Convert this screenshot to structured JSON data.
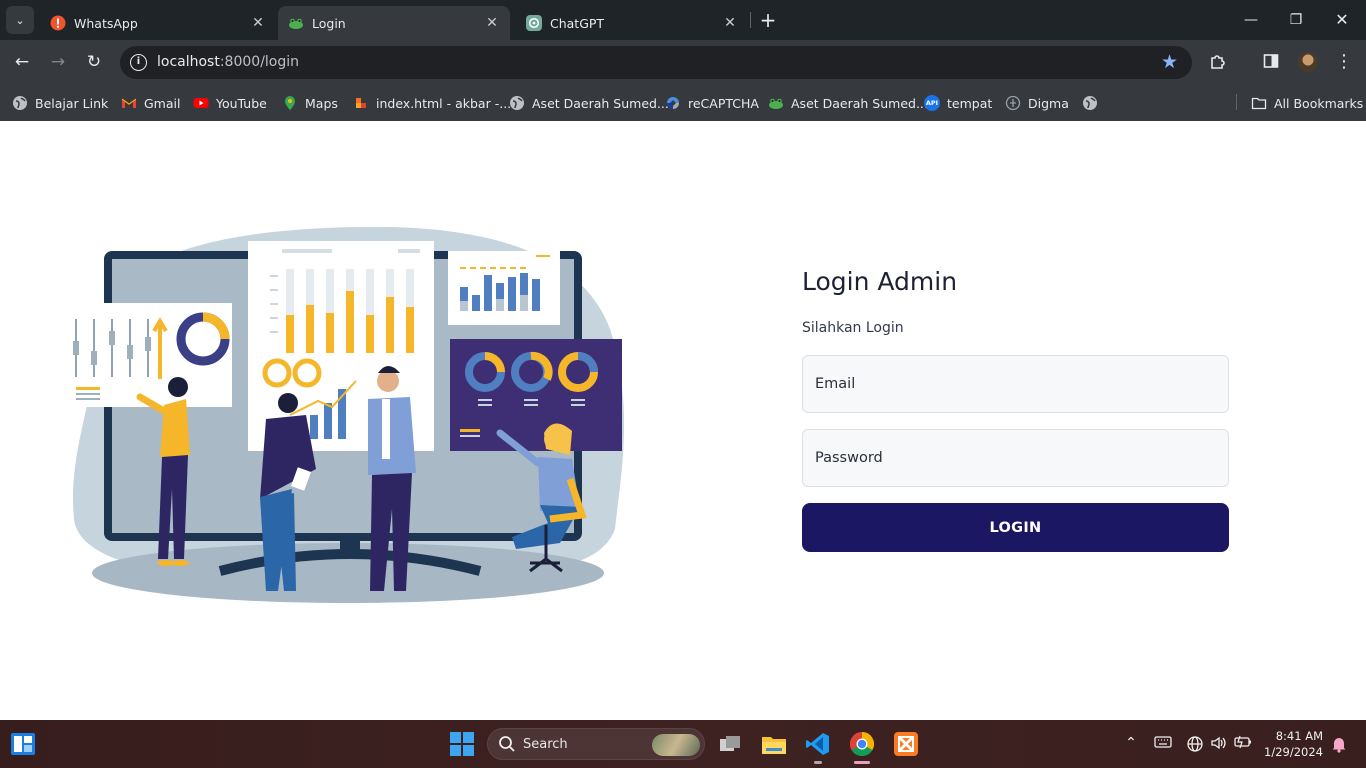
{
  "browser": {
    "tabs": [
      {
        "title": "WhatsApp",
        "favicon": "whatsapp-error-icon",
        "active": false
      },
      {
        "title": "Login",
        "favicon": "frog-icon",
        "active": true
      },
      {
        "title": "ChatGPT",
        "favicon": "chatgpt-icon",
        "active": false
      }
    ],
    "url_host": "localhost",
    "url_rest": ":8000/login",
    "bookmarks": [
      {
        "label": "Belajar Link",
        "icon": "globe-icon"
      },
      {
        "label": "Gmail",
        "icon": "gmail-icon"
      },
      {
        "label": "YouTube",
        "icon": "youtube-icon"
      },
      {
        "label": "Maps",
        "icon": "maps-icon"
      },
      {
        "label": "index.html - akbar -...",
        "icon": "gitlab-icon"
      },
      {
        "label": "Aset Daerah Sumed...",
        "icon": "globe-icon"
      },
      {
        "label": "reCAPTCHA",
        "icon": "recaptcha-icon"
      },
      {
        "label": "Aset Daerah Sumed...",
        "icon": "frog-icon"
      },
      {
        "label": "tempat",
        "icon": "api-icon"
      },
      {
        "label": "Digma",
        "icon": "digma-icon"
      }
    ],
    "all_bookmarks": "All Bookmarks",
    "api_badge": "API"
  },
  "login": {
    "title": "Login Admin",
    "subtitle": "Silahkan Login",
    "email_placeholder": "Email",
    "password_placeholder": "Password",
    "button": "LOGIN"
  },
  "taskbar": {
    "search_label": "Search",
    "time": "8:41 AM",
    "date": "1/29/2024"
  }
}
